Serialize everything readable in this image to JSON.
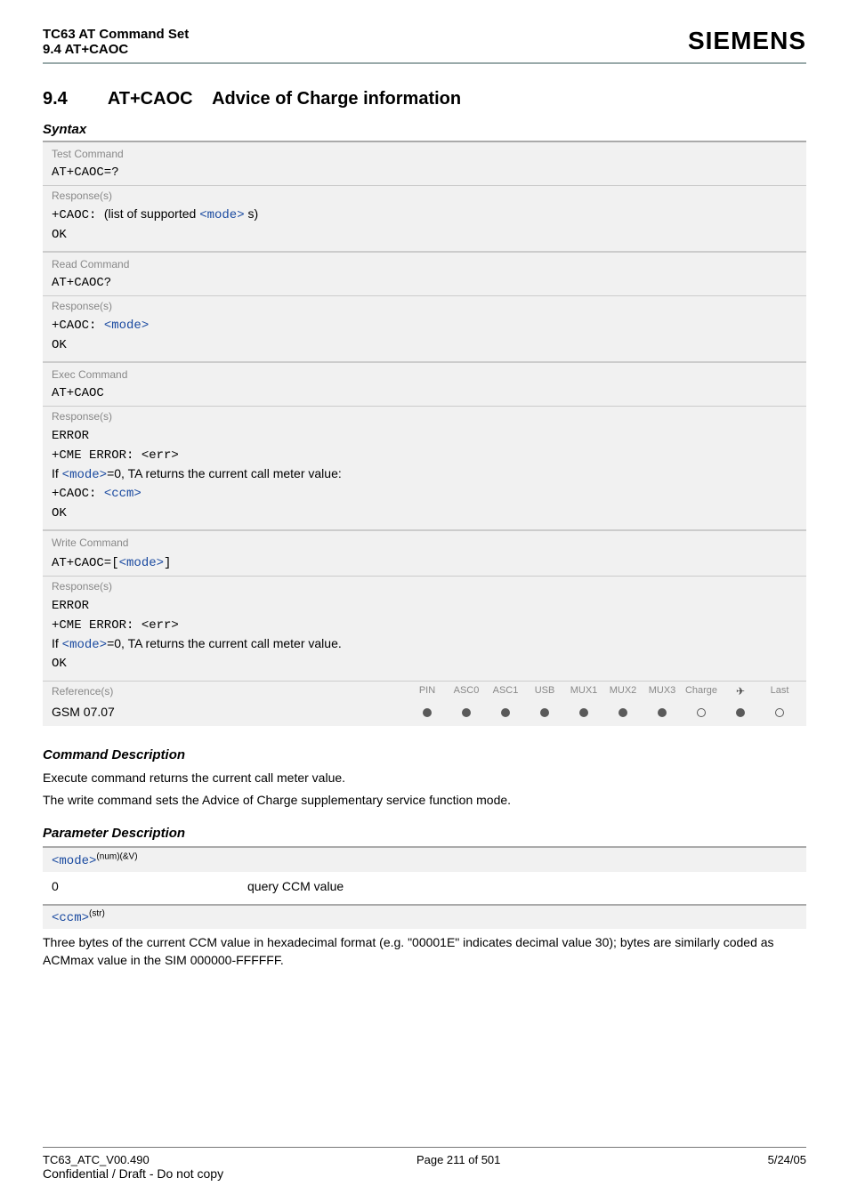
{
  "header": {
    "doc_title": "TC63 AT Command Set",
    "section_ref": "9.4 AT+CAOC",
    "brand": "SIEMENS"
  },
  "section": {
    "number": "9.4",
    "cmd": "AT+CAOC",
    "title": "Advice of Charge information"
  },
  "labels": {
    "syntax": "Syntax",
    "test_command": "Test Command",
    "read_command": "Read Command",
    "exec_command": "Exec Command",
    "write_command": "Write Command",
    "responses": "Response(s)",
    "references": "Reference(s)",
    "command_description": "Command Description",
    "parameter_description": "Parameter Description"
  },
  "test": {
    "cmd": "AT+CAOC=?",
    "resp_prefix": "+CAOC: ",
    "resp_text": "(list of supported",
    "resp_param": "<mode>",
    "resp_suffix": "s)",
    "ok": "OK"
  },
  "read": {
    "cmd": "AT+CAOC?",
    "resp_prefix": "+CAOC: ",
    "resp_param": "<mode>",
    "ok": "OK"
  },
  "exec": {
    "cmd": "AT+CAOC",
    "error": "ERROR",
    "cme": "+CME ERROR: <err>",
    "if_text_pre": "If ",
    "if_param": "<mode>",
    "if_text_post": "=0, TA returns the current call meter value:",
    "resp_prefix": "+CAOC: ",
    "resp_param": "<ccm>",
    "ok": "OK"
  },
  "write": {
    "cmd_prefix": "AT+CAOC=[",
    "cmd_param": "<mode>",
    "cmd_suffix": "]",
    "error": "ERROR",
    "cme": "+CME ERROR: <err>",
    "if_text_pre": "If ",
    "if_param": "<mode>",
    "if_text_post": "=0, TA returns the current call meter value.",
    "ok": "OK"
  },
  "ref": {
    "cols": [
      "PIN",
      "ASC0",
      "ASC1",
      "USB",
      "MUX1",
      "MUX2",
      "MUX3",
      "Charge",
      "✈",
      "Last"
    ],
    "name": "GSM 07.07",
    "dots": [
      "f",
      "f",
      "f",
      "f",
      "f",
      "f",
      "f",
      "e",
      "f",
      "e"
    ]
  },
  "desc": {
    "p1": "Execute command returns the current call meter value.",
    "p2": "The write command sets the Advice of Charge supplementary service function mode."
  },
  "params": {
    "mode_name": "<mode>",
    "mode_sup": "(num)(&V)",
    "mode_val": "0",
    "mode_desc": "query CCM value",
    "ccm_name": "<ccm>",
    "ccm_sup": "(str)",
    "ccm_desc": "Three bytes of the current CCM value in hexadecimal format (e.g. \"00001E\" indicates decimal value 30); bytes are similarly coded as ACMmax value in the SIM 000000-FFFFFF."
  },
  "footer": {
    "left": "TC63_ATC_V00.490",
    "center": "Page 211 of 501",
    "right": "5/24/05",
    "conf": "Confidential / Draft - Do not copy"
  }
}
